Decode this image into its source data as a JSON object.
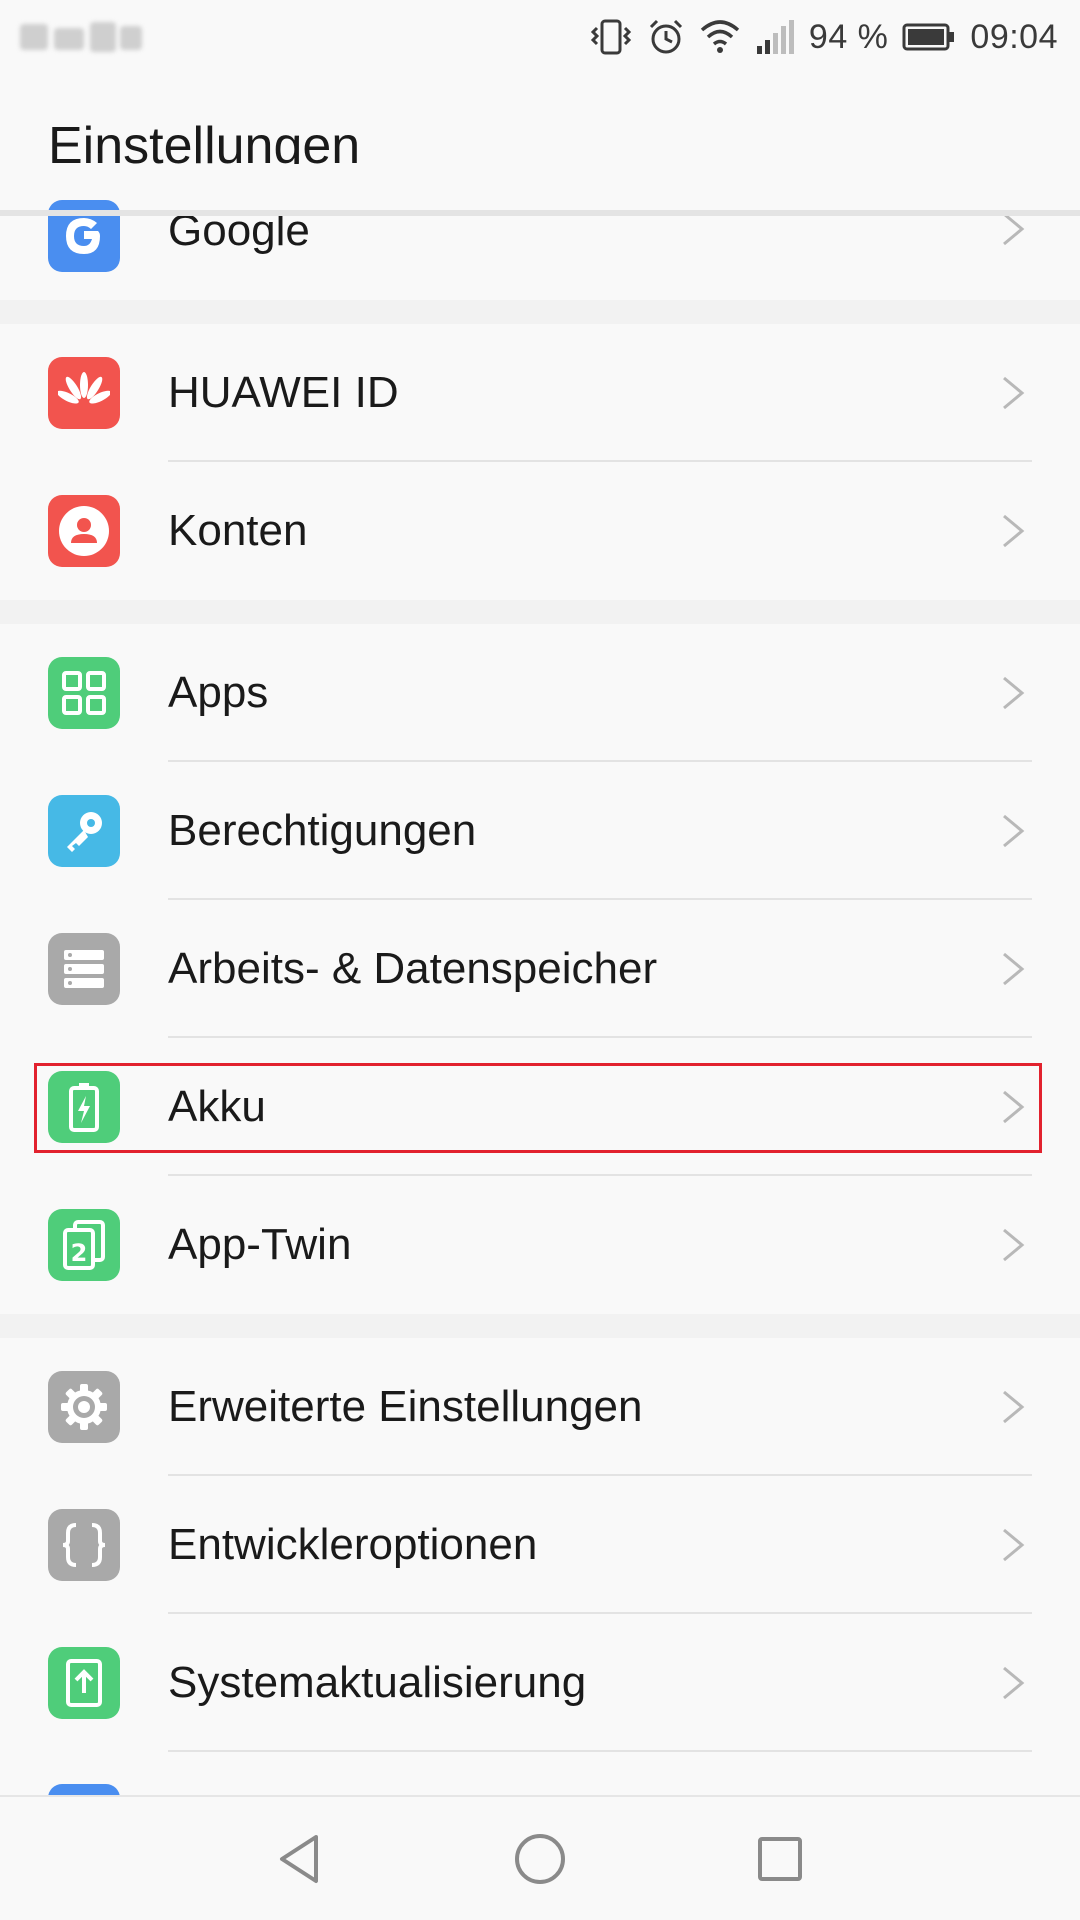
{
  "status_bar": {
    "battery_text": "94 %",
    "time": "09:04",
    "icons": [
      "vibrate-icon",
      "alarm-icon",
      "wifi-icon",
      "signal-icon",
      "battery-icon"
    ]
  },
  "header": {
    "title": "Einstellungen"
  },
  "groups": [
    {
      "items": [
        {
          "label": "Google",
          "icon": "google-icon",
          "color": "#4a8ef0"
        }
      ]
    },
    {
      "items": [
        {
          "label": "HUAWEI ID",
          "icon": "huawei-icon",
          "color": "#f2544e"
        },
        {
          "label": "Konten",
          "icon": "account-icon",
          "color": "#f2544e"
        }
      ]
    },
    {
      "items": [
        {
          "label": "Apps",
          "icon": "apps-grid-icon",
          "color": "#4fcd7a"
        },
        {
          "label": "Berechtigungen",
          "icon": "key-icon",
          "color": "#46b9e6"
        },
        {
          "label": "Arbeits- & Datenspeicher",
          "icon": "storage-icon",
          "color": "#a9a9a9"
        },
        {
          "label": "Akku",
          "icon": "battery-charging-icon",
          "color": "#4fcd7a"
        },
        {
          "label": "App-Twin",
          "icon": "app-twin-icon",
          "color": "#4fcd7a"
        }
      ]
    },
    {
      "items": [
        {
          "label": "Erweiterte Einstellungen",
          "icon": "gear-icon",
          "color": "#a9a9a9"
        },
        {
          "label": "Entwickleroptionen",
          "icon": "braces-icon",
          "color": "#a9a9a9"
        },
        {
          "label": "Systemaktualisierung",
          "icon": "system-update-icon",
          "color": "#4fcd7a"
        }
      ]
    }
  ],
  "highlighted_item": "Akku",
  "navbar": {
    "buttons": [
      "back-icon",
      "home-icon",
      "recents-icon"
    ]
  }
}
